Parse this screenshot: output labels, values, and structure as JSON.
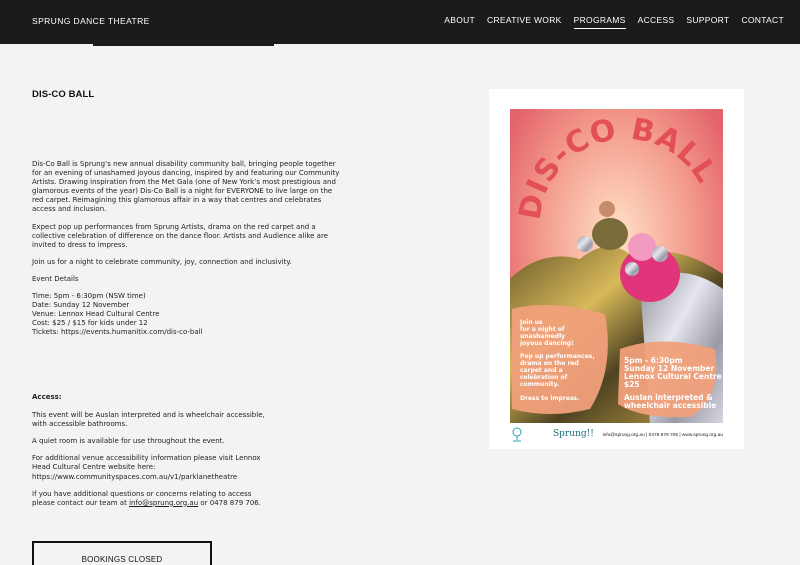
{
  "site": {
    "brand": "SPRUNG DANCE THEATRE"
  },
  "nav": {
    "items": [
      "ABOUT",
      "CREATIVE WORK",
      "PROGRAMS",
      "ACCESS",
      "SUPPORT",
      "CONTACT"
    ],
    "active": "PROGRAMS"
  },
  "page": {
    "title": "DIS-CO BALL"
  },
  "intro": {
    "p1": "Dis-Co Ball is Sprung’s new annual disability community ball, bringing people together for an evening of unashamed joyous dancing, inspired by and featuring our Community Artists. Drawing inspiration from the Met Gala (one of New York’s most prestigious and glamorous events of the year) Dis-Co Ball is a night for EVERYONE to live large on the red carpet. Reimagining this glamorous affair in a way that centres and celebrates access and inclusion.",
    "p2": "Expect pop up performances from Sprung Artists, drama on the red carpet and a collective celebration of difference on the dance floor. Artists and Audience alike are invited to dress to impress.",
    "p3": "Join us for a night to celebrate community, joy, connection and inclusivity.",
    "details_heading": "Event Details",
    "time": "Time: 5pm - 6:30pm (NSW time)",
    "date": "Date: Sunday 12 November",
    "venue": "Venue: Lennox Head Cultural Centre",
    "cost": "Cost: $25 / $15 for kids under 12",
    "tickets": "Tickets:  https://events.humanitix.com/dis-co-ball"
  },
  "access": {
    "heading": "Access:",
    "p1": "This event will be Auslan interpreted and is wheelchair accessible, with accessible bathrooms.",
    "p2": "A quiet room is available for use throughout the event.",
    "p3": "For additional venue accessibility information please visit Lennox Head Cultural Centre website here: https://www.communityspaces.com.au/v1/parklanetheatre",
    "p4_pre": "If you have additional questions or concerns relating to access please contact our team at ",
    "email": "info@sprung.org.au",
    "p4_post": " or 0478 879 706."
  },
  "bookings": {
    "label": "BOOKINGS CLOSED"
  },
  "poster": {
    "headline": "DIS-CO BALL",
    "left_blurb_1": "Join us",
    "left_blurb_2": "for a night of",
    "left_blurb_3": "unashamedly",
    "left_blurb_4": "joyous dancing!",
    "left_blurb_5": "Pop up performances,",
    "left_blurb_6": "drama on the red",
    "left_blurb_7": "carpet and a",
    "left_blurb_8": "celebration of",
    "left_blurb_9": "community.",
    "left_blurb_10": "Dress to impress.",
    "right_1": "5pm - 6:30pm",
    "right_2": "Sunday 12 November",
    "right_3": "Lennox Cultural Centre",
    "right_4": "$25",
    "right_5": "Auslan interpreted &",
    "right_6": "wheelchair accessible",
    "footer_logo": "Sprung!!",
    "footer_contact": "info@sprung.org.au | 0478 879 706 | www.sprung.org.au",
    "colors": {
      "bg": "#e9747a",
      "headline": "#e34f57",
      "blob": "#f0a07a",
      "text": "#ffffff"
    }
  }
}
